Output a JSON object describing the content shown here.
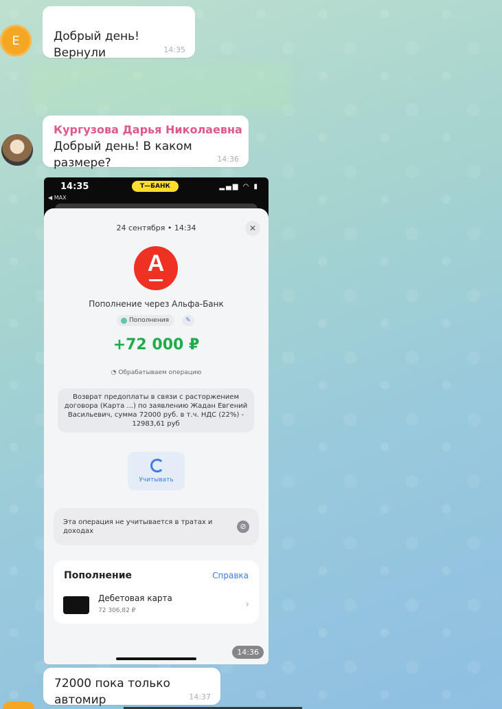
{
  "messages": [
    {
      "avatar_letter": "E",
      "text": "Добрый день! Вернули",
      "time": "14:35"
    },
    {
      "sender": "Кургузова Дарья Николаевна",
      "text": "Добрый день! В каком размере?",
      "time": "14:36"
    },
    {
      "text": "72000 пока только автомир",
      "time": "14:37"
    }
  ],
  "photo": {
    "time": "14:36",
    "phone": {
      "clock": "14:35",
      "back_label": "◀ MAX",
      "bank_badge": "Т—БАНК",
      "status_icons": "▂▄▆ ◠ ▮",
      "date": "24 сентября • 14:34",
      "close": "✕",
      "logo_letter": "А",
      "title": "Пополнение через Альфа-Банк",
      "tag": "Пополнения",
      "edit_icon": "✎",
      "amount": "+72 000 ₽",
      "processing": "◔ Обрабатываем операцию",
      "description": "Возврат предоплаты в связи с расторжением договора (Карта ...) по заявлению Жадан Евгений Васильевич, сумма 72000 руб. в т.ч. НДС (22%) - 12983,61 руб",
      "account_label": "Учитывать",
      "note": "Эта операция не учитывается в тратах и доходах",
      "note_icon": "⊘",
      "section_title": "Пополнение",
      "help_link": "Справка",
      "card_name": "Дебетовая карта",
      "card_balance": "72 306,82 ₽",
      "chevron": "›"
    }
  },
  "colors": {
    "accent": "#3c7be8",
    "sender_name": "#e0578a",
    "amount": "#1fad4c",
    "alfa_red": "#ef3124",
    "tbank_yellow": "#ffdd2d"
  }
}
